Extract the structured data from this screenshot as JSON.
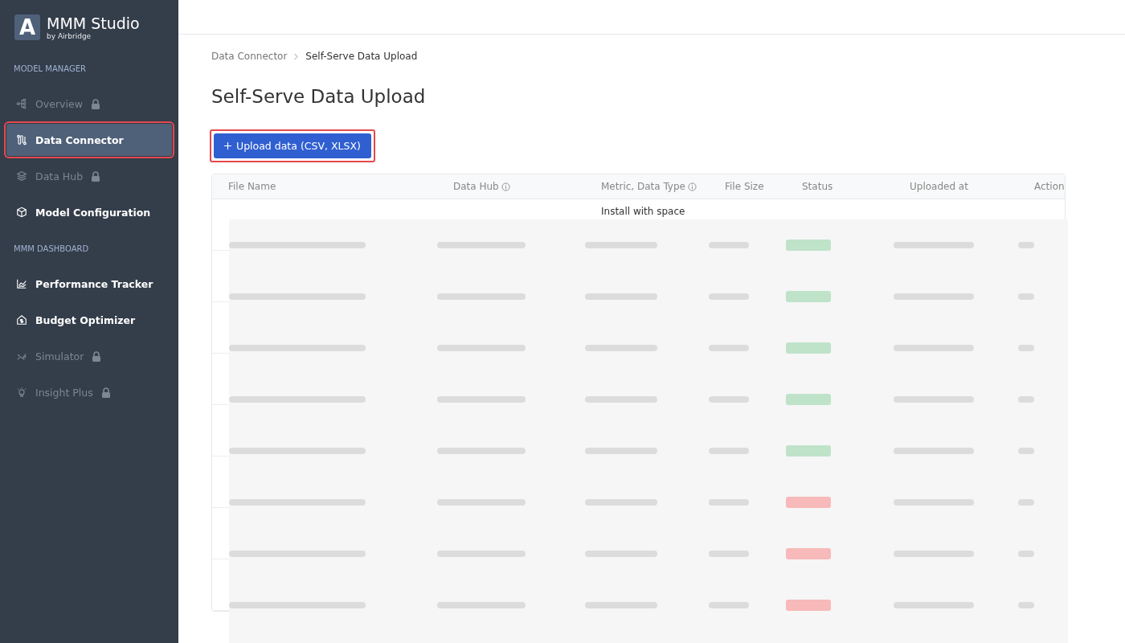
{
  "brand": {
    "logo_letter": "A",
    "name": "MMM Studio",
    "byline": "by Airbridge"
  },
  "sidebar": {
    "sections": [
      {
        "heading": "MODEL MANAGER",
        "items": [
          {
            "label": "Overview",
            "locked": true,
            "selected": false,
            "highlighted": false
          },
          {
            "label": "Data Connector",
            "locked": false,
            "selected": true,
            "highlighted": true
          },
          {
            "label": "Data Hub",
            "locked": true,
            "selected": false,
            "highlighted": false
          },
          {
            "label": "Model Configuration",
            "locked": false,
            "selected": false,
            "highlighted": false
          }
        ]
      },
      {
        "heading": "MMM DASHBOARD",
        "items": [
          {
            "label": "Performance Tracker",
            "locked": false,
            "selected": false,
            "highlighted": false
          },
          {
            "label": "Budget Optimizer",
            "locked": false,
            "selected": false,
            "highlighted": false
          },
          {
            "label": "Simulator",
            "locked": true,
            "selected": false,
            "highlighted": false
          },
          {
            "label": "Insight Plus",
            "locked": true,
            "selected": false,
            "highlighted": false
          }
        ]
      }
    ]
  },
  "breadcrumb": [
    "Data Connector",
    "Self-Serve Data Upload"
  ],
  "title": "Self-Serve Data Upload",
  "upload_button": {
    "label": "Upload data (CSV, XLSX)",
    "highlighted": true
  },
  "table": {
    "columns": [
      {
        "label": "File Name",
        "info": false
      },
      {
        "label": "Data Hub",
        "info": true
      },
      {
        "label": "Metric, Data Type",
        "info": true
      },
      {
        "label": "File Size",
        "info": false
      },
      {
        "label": "Status",
        "info": false
      },
      {
        "label": "Uploaded at",
        "info": false
      },
      {
        "label": "Action",
        "info": false
      }
    ],
    "first_row_metric": "Install with space",
    "rows": [
      {
        "color": "#bfe3c9"
      },
      {
        "color": "#bfe3c9"
      },
      {
        "color": "#bfe3c9"
      },
      {
        "color": "#bfe3c9"
      },
      {
        "color": "#bfe3c9"
      },
      {
        "color": "#f7b9b9"
      },
      {
        "color": "#f7b9b9"
      },
      {
        "color": "#f7b9b9"
      }
    ]
  }
}
